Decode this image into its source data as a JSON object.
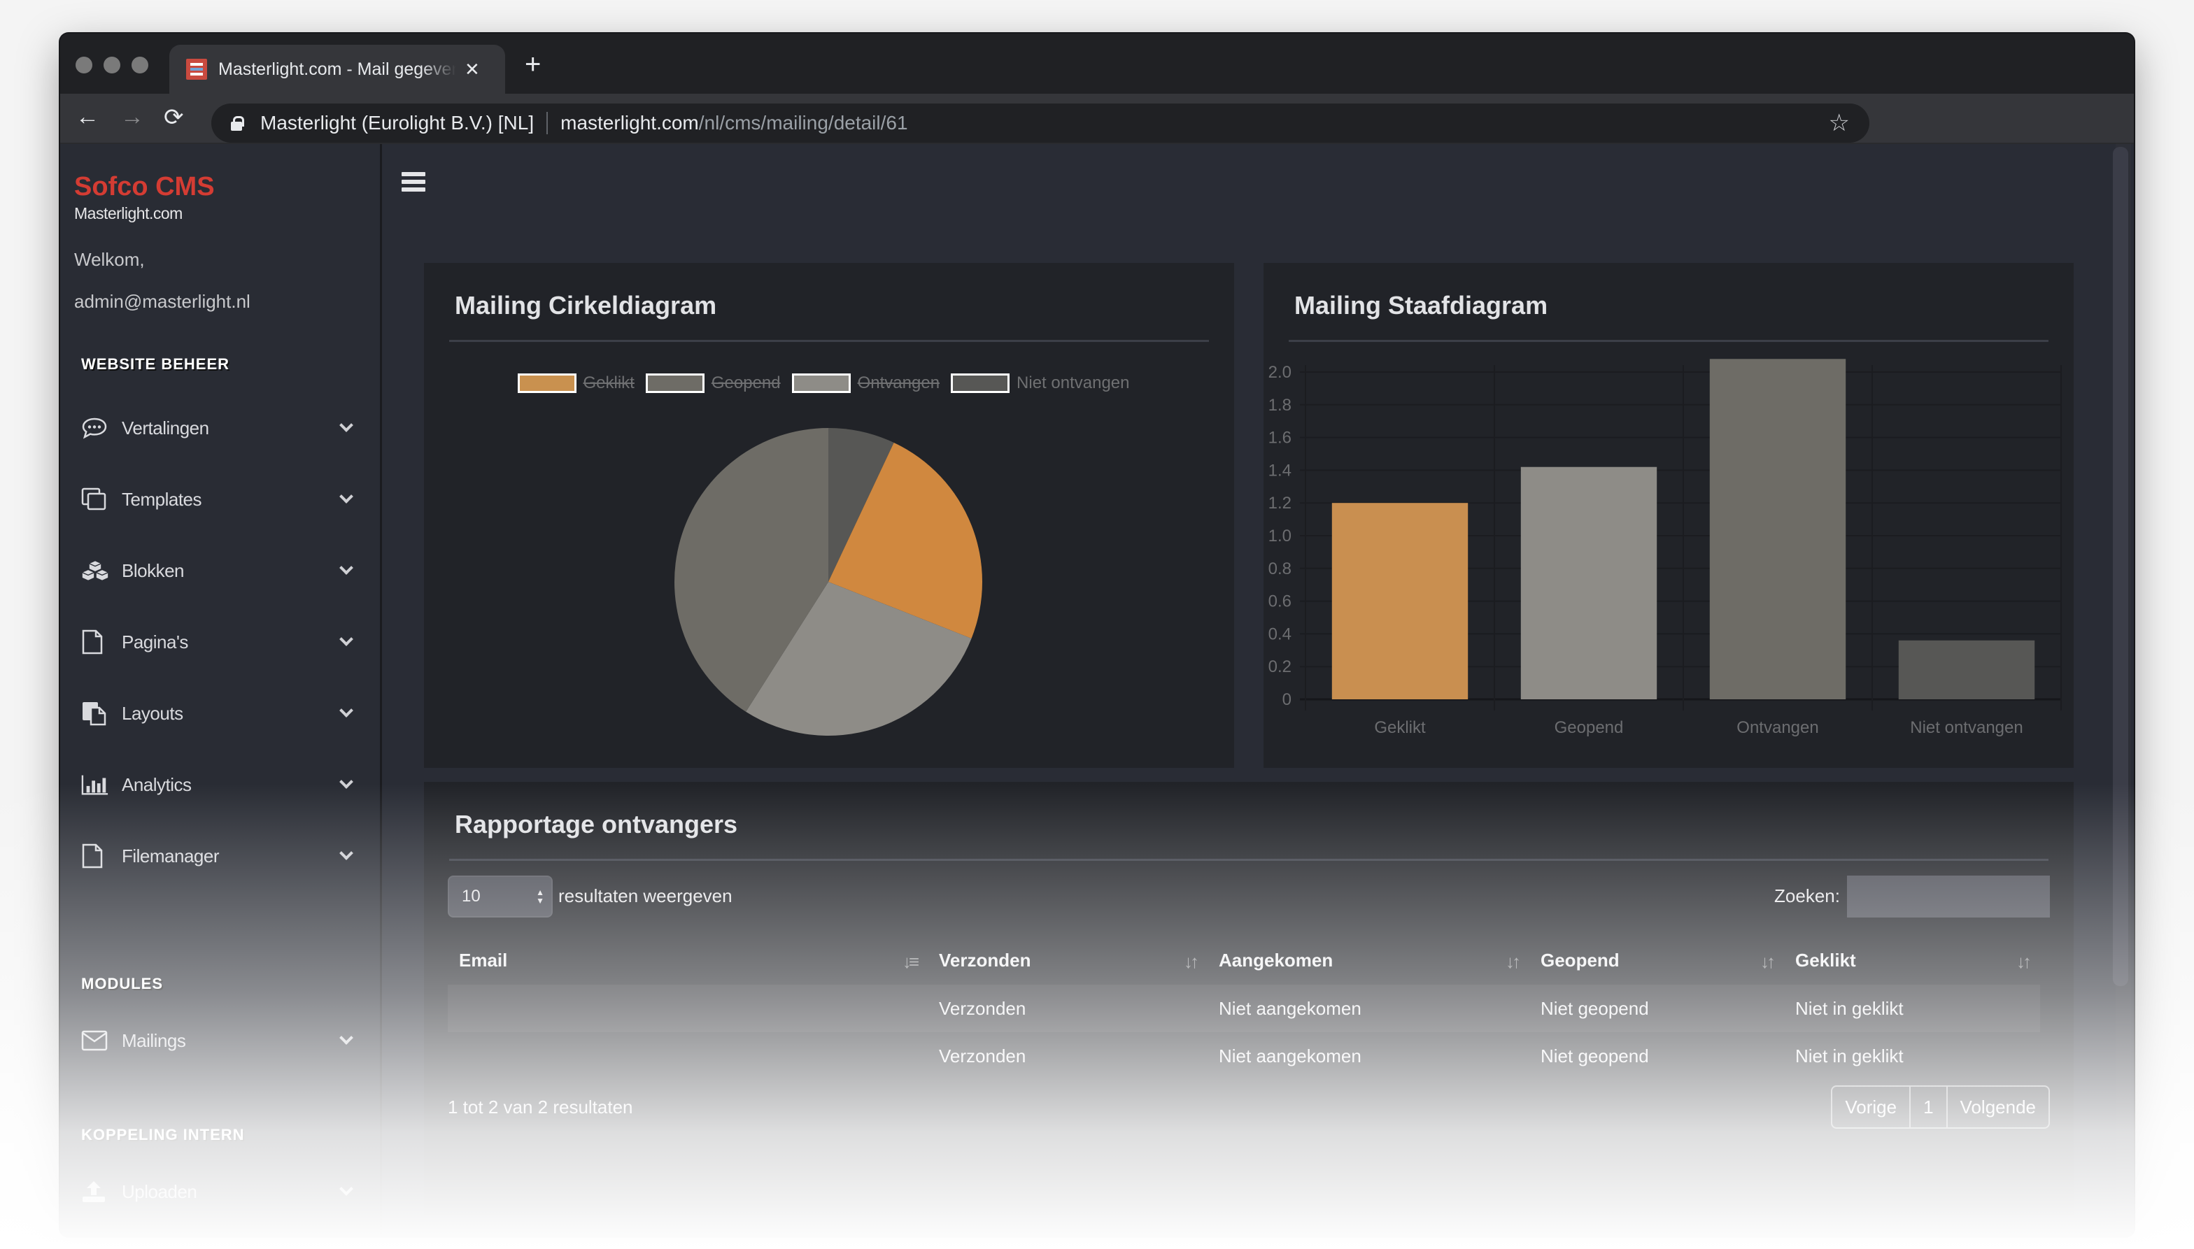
{
  "browser": {
    "tab_title": "Masterlight.com - Mail gegevens",
    "tab_close": "✕",
    "new_tab": "+",
    "back": "←",
    "forward": "→",
    "reload": "⟳",
    "site_identity": "Masterlight (Eurolight B.V.) [NL]",
    "url_host": "masterlight.com",
    "url_path": "/nl/cms/mailing/detail/61",
    "bookmark_icon": "☆"
  },
  "sidebar": {
    "brand": "Sofco CMS",
    "brand_sub": "Masterlight.com",
    "welcome": "Welkom,",
    "user_email": "admin@masterlight.nl",
    "sections": [
      {
        "title": "WEBSITE BEHEER",
        "items": [
          {
            "label": "Vertalingen",
            "icon": "comment-dots-icon"
          },
          {
            "label": "Templates",
            "icon": "clone-icon"
          },
          {
            "label": "Blokken",
            "icon": "cubes-icon"
          },
          {
            "label": "Pagina's",
            "icon": "file-icon"
          },
          {
            "label": "Layouts",
            "icon": "copy-file-icon"
          },
          {
            "label": "Analytics",
            "icon": "bar-chart-icon"
          },
          {
            "label": "Filemanager",
            "icon": "file-icon"
          }
        ]
      },
      {
        "title": "MODULES",
        "items": [
          {
            "label": "Mailings",
            "icon": "envelope-icon"
          }
        ]
      },
      {
        "title": "KOPPELING INTERN",
        "items": [
          {
            "label": "Uploaden",
            "icon": "upload-icon"
          }
        ]
      }
    ]
  },
  "pie_card": {
    "title": "Mailing Cirkeldiagram"
  },
  "bar_card": {
    "title": "Mailing Staafdiagram"
  },
  "colors": {
    "geklikt": "#d0883f",
    "geopend": "#8e8c87",
    "ontvangen": "#6e6c66",
    "niet_ontvangen": "#575755",
    "brand": "#d43c33"
  },
  "chart_data": [
    {
      "type": "pie",
      "title": "Mailing Cirkeldiagram",
      "legend_position": "top",
      "legend": [
        {
          "label": "Geklikt",
          "color": "#c9914f",
          "hidden": true
        },
        {
          "label": "Geopend",
          "color": "#6e6c66",
          "hidden": true
        },
        {
          "label": "Ontvangen",
          "color": "#8e8c87",
          "hidden": true
        },
        {
          "label": "Niet ontvangen",
          "color": "#575755",
          "hidden": false
        }
      ],
      "slices": [
        {
          "label": "Niet ontvangen",
          "value": 0.35,
          "color": "#575755"
        },
        {
          "label": "Geklikt",
          "value": 1.2,
          "color": "#d0883f"
        },
        {
          "label": "Geopend",
          "value": 1.4,
          "color": "#8e8c87"
        },
        {
          "label": "Ontvangen",
          "value": 2.05,
          "color": "#6e6c66"
        }
      ]
    },
    {
      "type": "bar",
      "title": "Mailing Staafdiagram",
      "categories": [
        "Geklikt",
        "Geopend",
        "Ontvangen",
        "Niet ontvangen"
      ],
      "values": [
        1.2,
        1.42,
        2.08,
        0.36
      ],
      "colors": [
        "#c98f50",
        "#8e8c87",
        "#6e6c66",
        "#575755"
      ],
      "ylim": [
        0,
        2.0
      ],
      "yticks": [
        "0",
        "0.2",
        "0.4",
        "0.6",
        "0.8",
        "1.0",
        "1.2",
        "1.4",
        "1.6",
        "1.8",
        "2.0"
      ],
      "grid": true,
      "xlabel": "",
      "ylabel": ""
    }
  ],
  "report": {
    "title": "Rapportage ontvangers",
    "page_length": "10",
    "page_length_label": "resultaten weergeven",
    "search_label": "Zoeken:",
    "search_value": "",
    "columns": [
      "Email",
      "Verzonden",
      "Aangekomen",
      "Geopend",
      "Geklikt"
    ],
    "rows": [
      [
        "",
        "Verzonden",
        "Niet aangekomen",
        "Niet geopend",
        "Niet in geklikt"
      ],
      [
        "",
        "Verzonden",
        "Niet aangekomen",
        "Niet geopend",
        "Niet in geklikt"
      ]
    ],
    "info": "1 tot 2 van 2 resultaten",
    "pager": {
      "prev": "Vorige",
      "current": "1",
      "next": "Volgende"
    }
  }
}
